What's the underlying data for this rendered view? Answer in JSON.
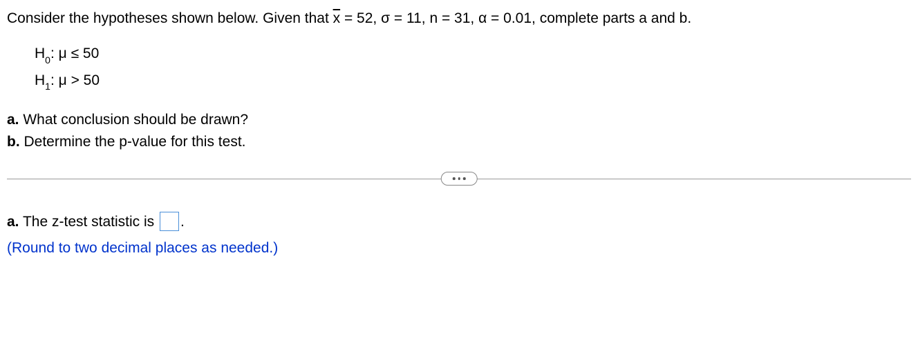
{
  "intro": {
    "prefix": "Consider the hypotheses shown below. Given that ",
    "xbar_sym": "x",
    "xbar_eq": " = 52, σ = 11, n = 31, α = 0.01, complete parts a and b."
  },
  "hyp": {
    "h0_label": "H",
    "h0_sub": "0",
    "h0_body": ": μ ≤ 50",
    "h1_label": "H",
    "h1_sub": "1",
    "h1_body": ": μ > 50"
  },
  "q": {
    "a_bold": "a.",
    "a_text": " What conclusion should be drawn?",
    "b_bold": "b.",
    "b_text": " Determine the p-value for this test."
  },
  "ans": {
    "a_bold": "a.",
    "a_text_before": " The z-test statistic is ",
    "a_text_after": ".",
    "hint": "(Round to two decimal places as needed.)",
    "input_value": ""
  }
}
